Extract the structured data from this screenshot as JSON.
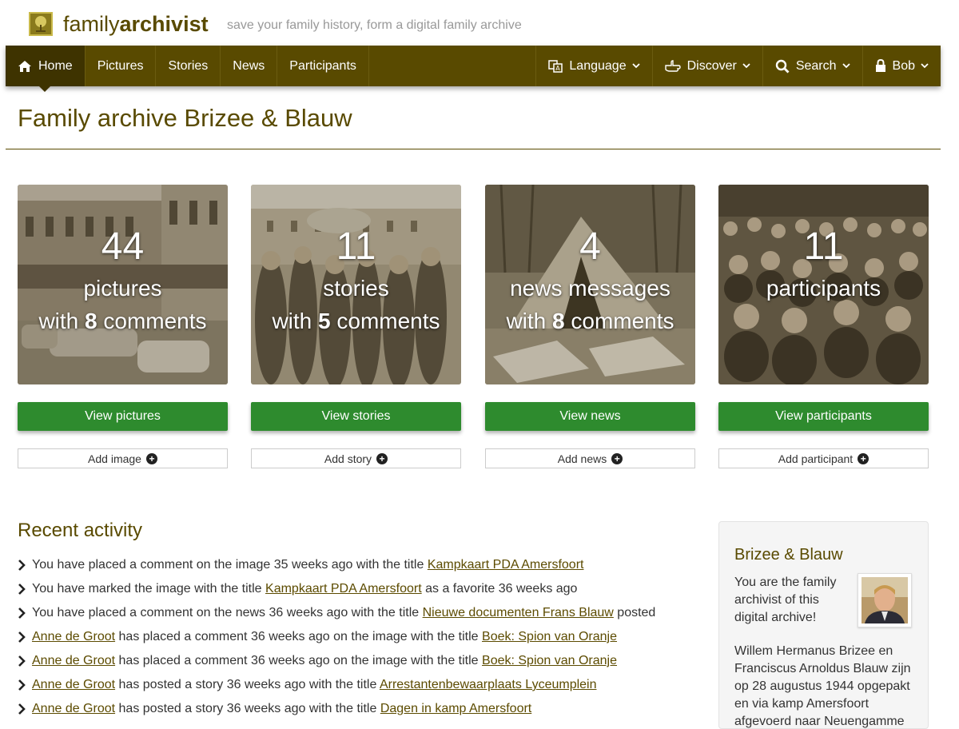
{
  "brand": {
    "name_light": "family",
    "name_bold": "archivist",
    "tagline": "save your family history, form a digital family archive"
  },
  "nav": {
    "left": [
      {
        "label": "Home",
        "icon": "home-icon",
        "active": true
      },
      {
        "label": "Pictures"
      },
      {
        "label": "Stories"
      },
      {
        "label": "News"
      },
      {
        "label": "Participants"
      }
    ],
    "right": [
      {
        "label": "Language",
        "icon": "language-icon"
      },
      {
        "label": "Discover",
        "icon": "hand-pointer-icon"
      },
      {
        "label": "Search",
        "icon": "search-icon"
      },
      {
        "label": "Bob",
        "icon": "lock-icon"
      }
    ]
  },
  "page_title": "Family archive Brizee & Blauw",
  "cards": [
    {
      "count": "44",
      "label": "pictures",
      "with": "with",
      "comments_count": "8",
      "comments": "comments",
      "view": "View pictures",
      "add": "Add image"
    },
    {
      "count": "11",
      "label": "stories",
      "with": "with",
      "comments_count": "5",
      "comments": "comments",
      "view": "View stories",
      "add": "Add story"
    },
    {
      "count": "4",
      "label": "news messages",
      "with": "with",
      "comments_count": "8",
      "comments": "comments",
      "view": "View news",
      "add": "Add news"
    },
    {
      "count": "11",
      "label": "participants",
      "with": "",
      "comments_count": "",
      "comments": "",
      "view": "View participants",
      "add": "Add participant"
    }
  ],
  "recent": {
    "title": "Recent activity",
    "items": [
      {
        "pre_link": "",
        "pre": "You have placed a comment on the image 35 weeks ago with the title ",
        "link": "Kampkaart PDA Amersfoort",
        "post": ""
      },
      {
        "pre_link": "",
        "pre": "You have marked the image with the title ",
        "link": "Kampkaart PDA Amersfoort",
        "post": " as a favorite 36 weeks ago"
      },
      {
        "pre_link": "",
        "pre": "You have placed a comment on the news 36 weeks ago with the title ",
        "link": "Nieuwe documenten Frans Blauw",
        "post": " posted"
      },
      {
        "pre_link": "Anne de Groot",
        "pre": " has placed a comment 36 weeks ago on the image with the title ",
        "link": "Boek: Spion van Oranje",
        "post": ""
      },
      {
        "pre_link": "Anne de Groot",
        "pre": " has placed a comment 36 weeks ago on the image with the title ",
        "link": "Boek: Spion van Oranje",
        "post": ""
      },
      {
        "pre_link": "Anne de Groot",
        "pre": " has posted a story 36 weeks ago with the title ",
        "link": "Arrestantenbewaarplaats Lyceumplein",
        "post": ""
      },
      {
        "pre_link": "Anne de Groot",
        "pre": " has posted a story 36 weeks ago with the title ",
        "link": "Dagen in kamp Amersfoort",
        "post": ""
      }
    ]
  },
  "sidebar": {
    "title": "Brizee & Blauw",
    "intro": "You are the family archivist of this digital archive!",
    "bio": "Willem Hermanus Brizee en Franciscus Arnoldus Blauw zijn op 28 augustus 1944 opgepakt en via kamp Amersfoort afgevoerd naar Neuengamme"
  },
  "colors": {
    "brand": "#594a00",
    "button_green": "#2e8b2e",
    "link": "#5c4b00"
  }
}
